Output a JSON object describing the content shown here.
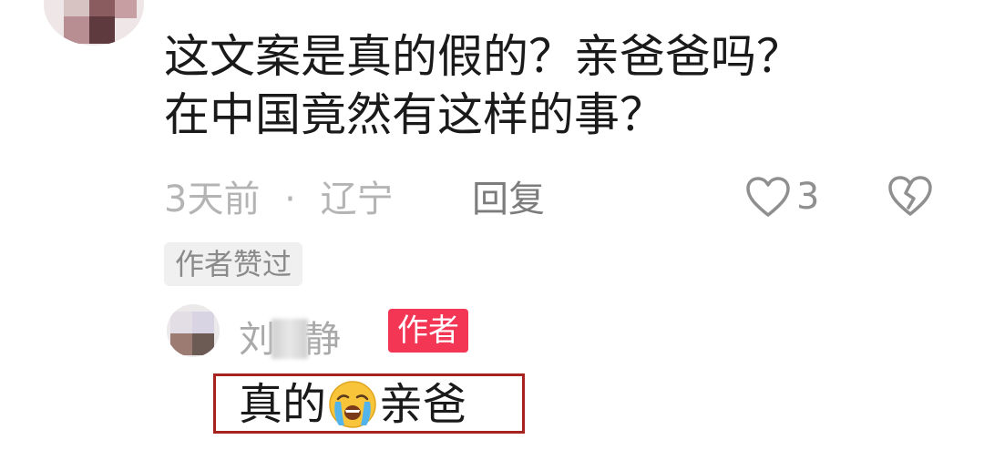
{
  "comment": {
    "username_partial": "",
    "text_lines": [
      "这文案是真的假的？亲爸爸吗？",
      "在中国竟然有这样的事？"
    ],
    "time": "3天前",
    "separator": "·",
    "location": "辽宁",
    "reply_label": "回复",
    "like_count": "3",
    "author_liked_tag": "作者赞过"
  },
  "reply": {
    "username_first": "刘",
    "username_last": "静",
    "author_badge": "作者",
    "text_before_emoji": "真的",
    "emoji_name": "loudly-crying-face",
    "text_after_emoji": "亲爸"
  },
  "colors": {
    "badge": "#f23654",
    "highlight_border": "#a7231f"
  }
}
